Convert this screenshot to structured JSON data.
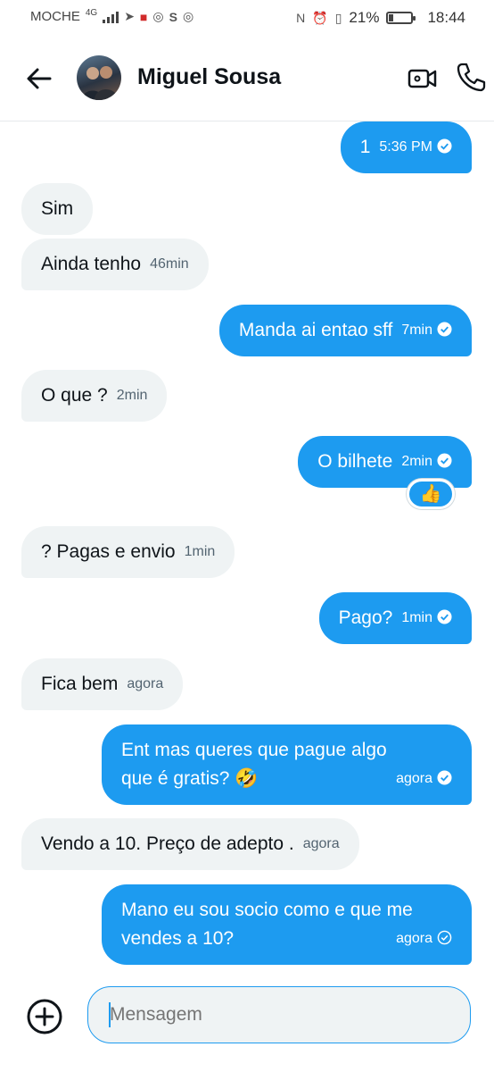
{
  "status_bar": {
    "carrier": "MOCHE",
    "network": "4G",
    "battery_percent": "21%",
    "battery_level": 0.21,
    "time": "18:44"
  },
  "header": {
    "contact_name": "Miguel Sousa",
    "icons": [
      "back-arrow-icon",
      "video-camera-icon",
      "phone-icon"
    ]
  },
  "messages": [
    {
      "dir": "out",
      "text": "1",
      "time": "5:36 PM"
    },
    {
      "dir": "in",
      "text": "Sim",
      "time": ""
    },
    {
      "dir": "in",
      "text": "Ainda tenho",
      "time": "46min"
    },
    {
      "dir": "out",
      "text": "Manda ai entao sff",
      "time": "7min"
    },
    {
      "dir": "in",
      "text": "O que ?",
      "time": "2min"
    },
    {
      "dir": "out",
      "text": "O bilhete",
      "time": "2min",
      "reaction": "👍"
    },
    {
      "dir": "in",
      "text": "? Pagas e envio",
      "time": "1min"
    },
    {
      "dir": "out",
      "text": "Pago?",
      "time": "1min"
    },
    {
      "dir": "in",
      "text": "Fica bem",
      "time": "agora"
    },
    {
      "dir": "out",
      "text": "Ent mas queres que pague algo que é gratis? 🤣",
      "time": "agora"
    },
    {
      "dir": "in",
      "text": "Vendo a 10. Preço de adepto  .",
      "time": "agora"
    },
    {
      "dir": "out",
      "text": "Mano eu sou socio como e que me vendes a 10?",
      "time": "agora"
    }
  ],
  "composer": {
    "placeholder": "Mensagem"
  },
  "colors": {
    "accent": "#1d9bf0",
    "incoming_bg": "#eff3f4",
    "muted_text": "#536471"
  }
}
